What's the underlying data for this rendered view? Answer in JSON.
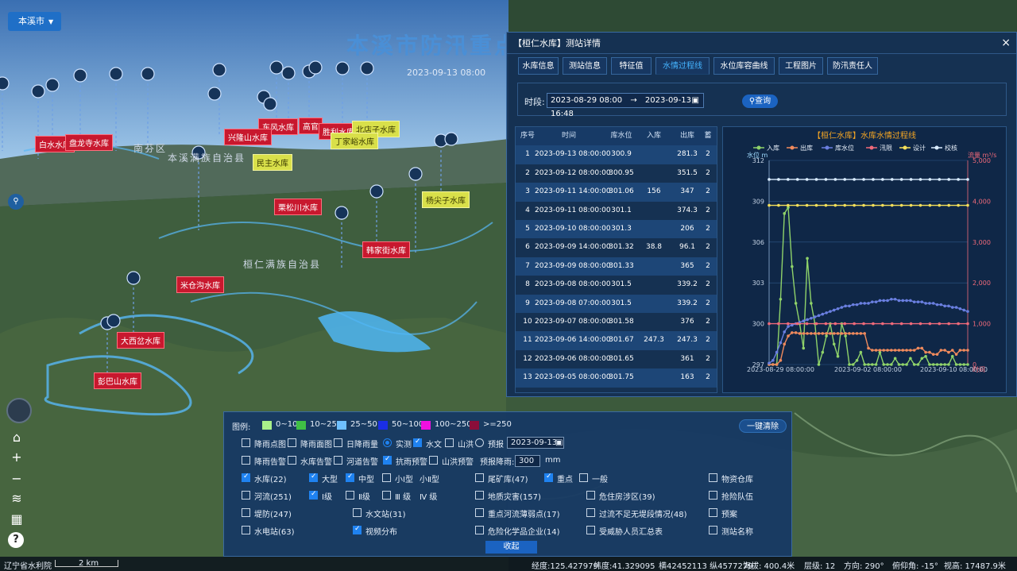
{
  "city_selector": {
    "label": "本溪市"
  },
  "map": {
    "title": "本溪市防汛重点",
    "datetime": "2023-09-13 08:00",
    "reservoirs": [
      "白水水库",
      "盘龙寺水库",
      "东风水库",
      "高官",
      "兴隆山水库",
      "胜利水库",
      "北店子水库",
      "丁家峪水库",
      "民主水库",
      "栗松川水库",
      "韩家街水库",
      "米仓沟水库",
      "大西岔水库",
      "彭巴山水库",
      "杨尖子水库"
    ],
    "places": [
      "南芬区",
      "本溪满族自治县",
      "桓仁满族自治县"
    ]
  },
  "dialog": {
    "title": "【桓仁水库】测站详情",
    "close": "×",
    "tabs": [
      "水库信息",
      "测站信息",
      "特征值",
      "水情过程线",
      "水位库容曲线",
      "工程图片",
      "防汛责任人"
    ],
    "active_tab": 3,
    "filter": {
      "label": "时段:",
      "start": "2023-08-29 08:00",
      "sep": "→",
      "end": "2023-09-13 16:48",
      "query": "查询"
    },
    "table": {
      "headers": [
        "序号",
        "时间",
        "库水位",
        "入库",
        "出库",
        "蓄"
      ],
      "rows": [
        [
          "1",
          "2023-09-13 08:00:00",
          "300.9",
          "",
          "281.3",
          "2"
        ],
        [
          "2",
          "2023-09-12 08:00:00",
          "300.95",
          "",
          "351.5",
          "2"
        ],
        [
          "3",
          "2023-09-11 14:00:00",
          "301.06",
          "156",
          "347",
          "2"
        ],
        [
          "4",
          "2023-09-11 08:00:00",
          "301.1",
          "",
          "374.3",
          "2"
        ],
        [
          "5",
          "2023-09-10 08:00:00",
          "301.3",
          "",
          "206",
          "2"
        ],
        [
          "6",
          "2023-09-09 14:00:00",
          "301.32",
          "38.8",
          "96.1",
          "2"
        ],
        [
          "7",
          "2023-09-09 08:00:00",
          "301.33",
          "",
          "365",
          "2"
        ],
        [
          "8",
          "2023-09-08 08:00:00",
          "301.5",
          "",
          "339.2",
          "2"
        ],
        [
          "9",
          "2023-09-08 07:00:00",
          "301.5",
          "",
          "339.2",
          "2"
        ],
        [
          "10",
          "2023-09-07 08:00:00",
          "301.58",
          "",
          "376",
          "2"
        ],
        [
          "11",
          "2023-09-06 14:00:00",
          "301.67",
          "247.3",
          "247.3",
          "2"
        ],
        [
          "12",
          "2023-09-06 08:00:00",
          "301.65",
          "",
          "361",
          "2"
        ],
        [
          "13",
          "2023-09-05 08:00:00",
          "301.75",
          "",
          "163",
          "2"
        ]
      ]
    }
  },
  "chart_data": {
    "type": "line",
    "title": "【桓仁水库】水库水情过程线",
    "y_left_label": "水位 m",
    "y_right_label": "流量 m³/s",
    "x_right_label": "时间",
    "ylim_left": [
      297,
      312
    ],
    "ylim_right": [
      0,
      5000
    ],
    "y_left_ticks": [
      "297",
      "300",
      "303",
      "306",
      "309",
      "312"
    ],
    "y_right_ticks": [
      "0",
      "1,000",
      "2,000",
      "3,000",
      "4,000",
      "5,000"
    ],
    "x_ticks": [
      "2023-08-29 08:00:00",
      "2023-09-02 08:00:00",
      "2023-09-10 08:00:00"
    ],
    "legend": [
      {
        "name": "入库",
        "color": "#8fd36a"
      },
      {
        "name": "出库",
        "color": "#f08a5d"
      },
      {
        "name": "库水位",
        "color": "#6a7fe0"
      },
      {
        "name": "汛限",
        "color": "#f06a7a"
      },
      {
        "name": "设计",
        "color": "#f5e05a"
      },
      {
        "name": "校核",
        "color": "#d9ecff"
      }
    ],
    "series": [
      {
        "name": "入库",
        "axis": "right",
        "values": [
          0,
          0,
          0,
          1600,
          3700,
          3850,
          2400,
          1500,
          1000,
          400,
          2600,
          1500,
          1000,
          0,
          300,
          700,
          1000,
          500,
          200,
          1000,
          700,
          0,
          0,
          100,
          300,
          0,
          0,
          0,
          0,
          300,
          0,
          0,
          0,
          150,
          0,
          0,
          0,
          150,
          0,
          0,
          150,
          200,
          0,
          0,
          0,
          0,
          0,
          0,
          200,
          0,
          0,
          0,
          0
        ]
      },
      {
        "name": "出库",
        "axis": "right",
        "values": [
          0,
          0,
          0,
          100,
          500,
          700,
          780,
          780,
          760,
          760,
          760,
          760,
          760,
          760,
          760,
          760,
          760,
          760,
          760,
          760,
          760,
          760,
          760,
          760,
          760,
          760,
          400,
          350,
          350,
          350,
          350,
          350,
          350,
          350,
          350,
          350,
          350,
          350,
          350,
          400,
          400,
          300,
          300,
          250,
          250,
          350,
          350,
          300,
          350,
          250,
          350,
          350,
          350
        ]
      },
      {
        "name": "库水位",
        "axis": "left",
        "values": [
          297.1,
          297.3,
          297.9,
          298.6,
          299.4,
          299.8,
          299.9,
          300.0,
          300.1,
          300.2,
          300.3,
          300.4,
          300.5,
          300.6,
          300.7,
          300.8,
          300.9,
          301.0,
          301.1,
          301.2,
          301.3,
          301.3,
          301.4,
          301.4,
          301.5,
          301.5,
          301.5,
          301.6,
          301.6,
          301.7,
          301.7,
          301.7,
          301.8,
          301.8,
          301.7,
          301.7,
          301.7,
          301.7,
          301.6,
          301.6,
          301.6,
          301.5,
          301.5,
          301.5,
          301.4,
          301.4,
          301.3,
          301.3,
          301.2,
          301.2,
          301.1,
          301.0,
          300.9
        ]
      },
      {
        "name": "汛限",
        "axis": "left",
        "values": [
          300
        ]
      },
      {
        "name": "设计",
        "axis": "left",
        "values": [
          308.7
        ]
      },
      {
        "name": "校核",
        "axis": "left",
        "values": [
          310.6
        ]
      }
    ]
  },
  "legend_panel": {
    "legend_label": "图例:",
    "ranges": [
      {
        "label": "0~10",
        "color": "#a8f08a"
      },
      {
        "label": "10~25",
        "color": "#3fbf45"
      },
      {
        "label": "25~50",
        "color": "#6ec0ff"
      },
      {
        "label": "50~100",
        "color": "#1a2ee6"
      },
      {
        "label": "100~250",
        "color": "#f010e0"
      },
      {
        "label": ">=250",
        "color": "#8a0e3a"
      }
    ],
    "clear": "一键清除",
    "collapse": "收起",
    "date": "2023-09-13",
    "forecast_rain_label": "预报降雨:",
    "forecast_rain_value": "300",
    "forecast_rain_unit": "mm",
    "row1": [
      "降雨点图",
      "降雨面图",
      "日降雨量",
      "实测",
      "水文",
      "山洪",
      "预报"
    ],
    "row2": [
      "降雨告警",
      "水库告警",
      "河道告警",
      "抗雨预警",
      "山洪预警"
    ],
    "row3": [
      "水库(22)",
      "大型",
      "中型",
      "小Ⅰ型",
      "小Ⅱ型",
      "尾矿库(47)",
      "重点",
      "一般",
      "物资仓库"
    ],
    "row4": [
      "河流(251)",
      "Ⅰ级",
      "Ⅱ级",
      "Ⅲ 级",
      "Ⅳ 级",
      "地质灾害(157)",
      "危住房涉区(39)",
      "抢险队伍"
    ],
    "row5": [
      "堤防(247)",
      "水文站(31)",
      "重点河流薄弱点(17)",
      "过流不足无堤段情况(48)",
      "预案"
    ],
    "row6": [
      "水电站(63)",
      "视频分布",
      "危险化学品企业(14)",
      "受威胁人员汇总表",
      "测站名称"
    ]
  },
  "status": {
    "org": "辽宁省水利院",
    "scale": "2 km",
    "lon": "经度:125.427979",
    "lat": "纬度:41.329095",
    "xy": "横42452113 纵4577279",
    "alt": "海拔: 400.4米",
    "level": "层级:  12",
    "heading": "方向:  290°",
    "pitch": "俯仰角:  -15°",
    "view": "视高:  17487.9米"
  }
}
